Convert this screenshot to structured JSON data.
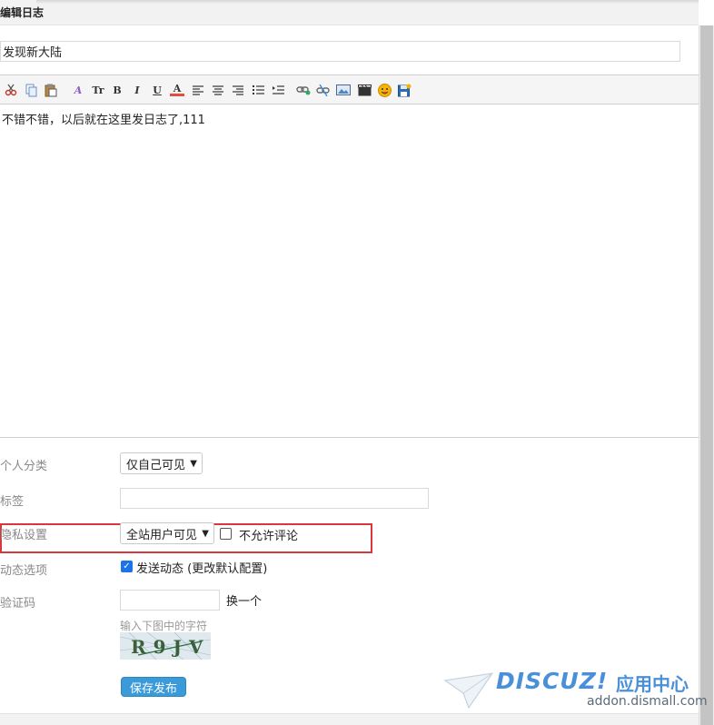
{
  "page": {
    "title": "编辑日志"
  },
  "blog": {
    "title_value": "发现新大陆",
    "content": "不错不错，以后就在这里发日志了,111"
  },
  "toolbar": {
    "buttons": [
      "cut-icon",
      "copy-icon",
      "paste-icon",
      "font-icon",
      "font-size-icon",
      "bold-icon",
      "italic-icon",
      "underline-icon",
      "font-color-icon",
      "align-left-icon",
      "align-center-icon",
      "align-right-icon",
      "ordered-list-icon",
      "indent-icon",
      "link-icon",
      "unlink-icon",
      "image-icon",
      "video-icon",
      "emoticon-icon",
      "save-draft-icon"
    ],
    "labels": {
      "font_size": "Tr",
      "bold": "B",
      "italic": "I",
      "underline": "U",
      "font_color": "A",
      "font": "A"
    }
  },
  "form": {
    "category": {
      "label": "个人分类",
      "selected": "仅自己可见"
    },
    "tags": {
      "label": "标签",
      "value": ""
    },
    "privacy": {
      "label": "隐私设置",
      "selected": "全站用户可见",
      "no_comment_label": "不允许评论",
      "no_comment_checked": false
    },
    "feed": {
      "label": "动态选项",
      "text": "发送动态 (更改默认配置)",
      "checked": true
    },
    "captcha": {
      "label": "验证码",
      "value": "",
      "refresh": "换一个",
      "hint": "输入下图中的字符",
      "chars": "R9JV"
    }
  },
  "actions": {
    "save": "保存发布"
  },
  "watermark": {
    "brand": "DISCUZ!",
    "cn": "应用中心",
    "url": "addon.dismall.com"
  },
  "colors": {
    "accent": "#3b9bd8",
    "highlight_border": "#d9363e",
    "checkbox": "#1a73e8"
  }
}
